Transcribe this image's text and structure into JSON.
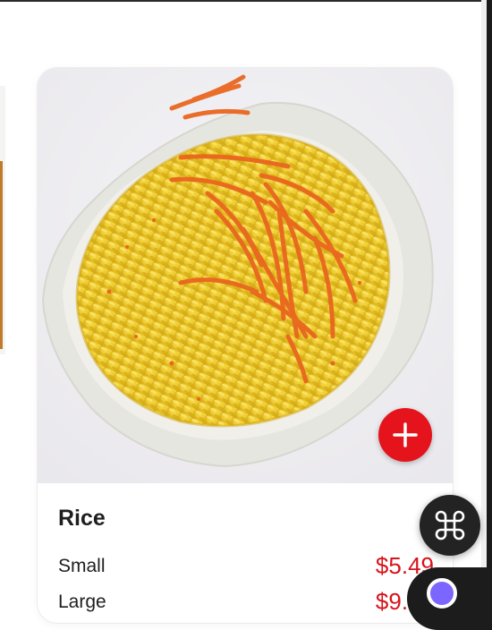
{
  "product": {
    "name": "Rice",
    "image_alt": "Yellow rice with shredded carrots on a white plate",
    "sizes": [
      {
        "name": "Small",
        "price": "$5.49"
      },
      {
        "name": "Large",
        "price": "$9.49"
      }
    ]
  },
  "icons": {
    "add": "plus-icon",
    "quick_menu": "command-icon",
    "chat": "chat-icon"
  },
  "colors": {
    "accent": "#e5141c",
    "price": "#d7141c",
    "fab": "#232323"
  }
}
